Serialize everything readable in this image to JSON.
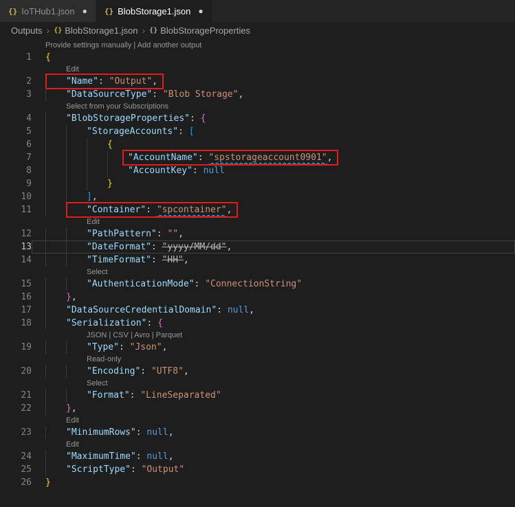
{
  "tabs": [
    {
      "icon": "{}",
      "label": "IoTHub1.json",
      "modified_dot": "●"
    },
    {
      "icon": "{}",
      "label": "BlobStorage1.json",
      "modified_dot": "●"
    }
  ],
  "breadcrumb": {
    "separator": "›",
    "items": [
      {
        "label": "Outputs"
      },
      {
        "icon": "{}",
        "label": "BlobStorage1.json"
      },
      {
        "icon": "{}",
        "label": "BlobStorageProperties"
      }
    ]
  },
  "colors": {
    "key": "#9cdcfe",
    "string": "#ce9178",
    "keyword": "#569cd6",
    "bracket1": "#ffd700",
    "bracket2": "#da70d6",
    "bracket3": "#179fff",
    "annotation_box": "#e11d1d"
  },
  "editor": {
    "rows": [
      {
        "type": "lens",
        "i": 0,
        "text": "Provide settings manually | Add another output"
      },
      {
        "type": "code",
        "n": 1,
        "i": 0,
        "t": [
          [
            "b1",
            "{"
          ]
        ]
      },
      {
        "type": "lens",
        "i": 1,
        "text": "Edit"
      },
      {
        "type": "code",
        "n": 2,
        "i": 1,
        "box": {
          "pre": 28
        },
        "t": [
          [
            "k",
            "\"Name\""
          ],
          [
            "p",
            ": "
          ],
          [
            "s",
            "\"Output\""
          ],
          [
            "p",
            ","
          ]
        ]
      },
      {
        "type": "code",
        "n": 3,
        "i": 1,
        "t": [
          [
            "k",
            "\"DataSourceType\""
          ],
          [
            "p",
            ": "
          ],
          [
            "s",
            "\"Blob Storage\""
          ],
          [
            "p",
            ","
          ]
        ]
      },
      {
        "type": "lens",
        "i": 1,
        "text": "Select from your Subscriptions"
      },
      {
        "type": "code",
        "n": 4,
        "i": 1,
        "t": [
          [
            "k",
            "\"BlobStorageProperties\""
          ],
          [
            "p",
            ": "
          ],
          [
            "b2",
            "{"
          ]
        ]
      },
      {
        "type": "code",
        "n": 5,
        "i": 2,
        "t": [
          [
            "k",
            "\"StorageAccounts\""
          ],
          [
            "p",
            ": "
          ],
          [
            "b3",
            "["
          ]
        ]
      },
      {
        "type": "code",
        "n": 6,
        "i": 3,
        "t": [
          [
            "b1",
            "{"
          ]
        ]
      },
      {
        "type": "code",
        "n": 7,
        "i": 4,
        "box": {
          "pre": 6
        },
        "t": [
          [
            "k",
            "\"AccountName\""
          ],
          [
            "p",
            ": "
          ],
          [
            "s sq",
            "\"spstorageaccount0901\""
          ],
          [
            "p",
            ","
          ]
        ]
      },
      {
        "type": "code",
        "n": 8,
        "i": 4,
        "t": [
          [
            "k",
            "\"AccountKey\""
          ],
          [
            "p",
            ": "
          ],
          [
            "n",
            "null"
          ]
        ]
      },
      {
        "type": "code",
        "n": 9,
        "i": 3,
        "t": [
          [
            "b1",
            "}"
          ]
        ]
      },
      {
        "type": "code",
        "n": 10,
        "i": 2,
        "t": [
          [
            "b3",
            "]"
          ],
          [
            "p",
            ","
          ]
        ]
      },
      {
        "type": "code",
        "n": 11,
        "i": 2,
        "box": {
          "pre": 28
        },
        "t": [
          [
            "k",
            "\"Container\""
          ],
          [
            "p",
            ": "
          ],
          [
            "s sq",
            "\"spcontainer\""
          ],
          [
            "p",
            ","
          ]
        ]
      },
      {
        "type": "lens",
        "i": 2,
        "text": "Edit"
      },
      {
        "type": "code",
        "n": 12,
        "i": 2,
        "t": [
          [
            "k",
            "\"PathPattern\""
          ],
          [
            "p",
            ": "
          ],
          [
            "s",
            "\"\""
          ],
          [
            "p",
            ","
          ]
        ]
      },
      {
        "type": "code",
        "n": 13,
        "i": 2,
        "cur": true,
        "t": [
          [
            "k",
            "\"DateFormat\""
          ],
          [
            "p",
            ": "
          ],
          [
            "st",
            "\"yyyy/MM/dd\""
          ],
          [
            "p",
            ","
          ]
        ]
      },
      {
        "type": "code",
        "n": 14,
        "i": 2,
        "t": [
          [
            "k",
            "\"TimeFormat\""
          ],
          [
            "p",
            ": "
          ],
          [
            "st",
            "\"HH\""
          ],
          [
            "p",
            ","
          ]
        ]
      },
      {
        "type": "lens",
        "i": 2,
        "text": "Select"
      },
      {
        "type": "code",
        "n": 15,
        "i": 2,
        "t": [
          [
            "k",
            "\"AuthenticationMode\""
          ],
          [
            "p",
            ": "
          ],
          [
            "s",
            "\"ConnectionString\""
          ]
        ]
      },
      {
        "type": "code",
        "n": 16,
        "i": 1,
        "t": [
          [
            "b2",
            "}"
          ],
          [
            "p",
            ","
          ]
        ]
      },
      {
        "type": "code",
        "n": 17,
        "i": 1,
        "t": [
          [
            "k",
            "\"DataSourceCredentialDomain\""
          ],
          [
            "p",
            ": "
          ],
          [
            "n",
            "null"
          ],
          [
            "p",
            ","
          ]
        ]
      },
      {
        "type": "code",
        "n": 18,
        "i": 1,
        "t": [
          [
            "k",
            "\"Serialization\""
          ],
          [
            "p",
            ": "
          ],
          [
            "b2",
            "{"
          ]
        ]
      },
      {
        "type": "lens",
        "i": 2,
        "text": "JSON | CSV | Avro | Parquet"
      },
      {
        "type": "code",
        "n": 19,
        "i": 2,
        "t": [
          [
            "k",
            "\"Type\""
          ],
          [
            "p",
            ": "
          ],
          [
            "s",
            "\"Json\""
          ],
          [
            "p",
            ","
          ]
        ]
      },
      {
        "type": "lens",
        "i": 2,
        "text": "Read-only"
      },
      {
        "type": "code",
        "n": 20,
        "i": 2,
        "t": [
          [
            "k",
            "\"Encoding\""
          ],
          [
            "p",
            ": "
          ],
          [
            "s",
            "\"UTF8\""
          ],
          [
            "p",
            ","
          ]
        ]
      },
      {
        "type": "lens",
        "i": 2,
        "text": "Select"
      },
      {
        "type": "code",
        "n": 21,
        "i": 2,
        "t": [
          [
            "k",
            "\"Format\""
          ],
          [
            "p",
            ": "
          ],
          [
            "s",
            "\"LineSeparated\""
          ]
        ]
      },
      {
        "type": "code",
        "n": 22,
        "i": 1,
        "t": [
          [
            "b2",
            "}"
          ],
          [
            "p",
            ","
          ]
        ]
      },
      {
        "type": "lens",
        "i": 1,
        "text": "Edit"
      },
      {
        "type": "code",
        "n": 23,
        "i": 1,
        "t": [
          [
            "k",
            "\"MinimumRows\""
          ],
          [
            "p",
            ": "
          ],
          [
            "n",
            "null"
          ],
          [
            "p",
            ","
          ]
        ]
      },
      {
        "type": "lens",
        "i": 1,
        "text": "Edit"
      },
      {
        "type": "code",
        "n": 24,
        "i": 1,
        "t": [
          [
            "k",
            "\"MaximumTime\""
          ],
          [
            "p",
            ": "
          ],
          [
            "n",
            "null"
          ],
          [
            "p",
            ","
          ]
        ]
      },
      {
        "type": "code",
        "n": 25,
        "i": 1,
        "t": [
          [
            "k",
            "\"ScriptType\""
          ],
          [
            "p",
            ": "
          ],
          [
            "s",
            "\"Output\""
          ]
        ]
      },
      {
        "type": "code",
        "n": 26,
        "i": 0,
        "t": [
          [
            "b1",
            "}"
          ]
        ]
      }
    ]
  }
}
